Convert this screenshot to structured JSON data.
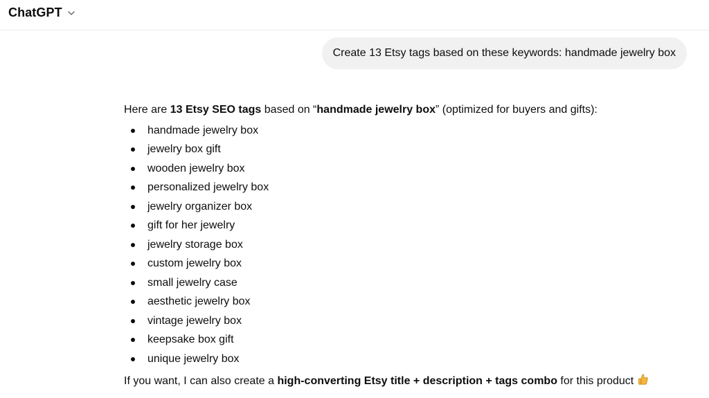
{
  "header": {
    "model_name": "ChatGPT",
    "chevron_icon": "chevron-down-icon"
  },
  "user_message": {
    "text": "Create 13 Etsy tags based on these keywords: handmade jewelry box"
  },
  "assistant_message": {
    "intro": {
      "part1": "Here are ",
      "bold1": "13 Etsy SEO tags",
      "part2": " based on “",
      "bold2": "handmade jewelry box",
      "part3": "” (optimized for buyers and gifts):"
    },
    "tags": [
      "handmade jewelry box",
      "jewelry box gift",
      "wooden jewelry box",
      "personalized jewelry box",
      "jewelry organizer box",
      "gift for her jewelry",
      "jewelry storage box",
      "custom jewelry box",
      "small jewelry case",
      "aesthetic jewelry box",
      "vintage jewelry box",
      "keepsake box gift",
      "unique jewelry box"
    ],
    "outro": {
      "part1": "If you want, I can also create a ",
      "bold": "high-converting Etsy title + description + tags combo",
      "part2": " for this product",
      "emoji_icon": "thumbs-up-emoji-icon"
    }
  },
  "colors": {
    "user_bubble_bg": "#f1f1f1",
    "text": "#0d0d0d",
    "divider": "#ececec",
    "emoji": "#f4b63f"
  }
}
